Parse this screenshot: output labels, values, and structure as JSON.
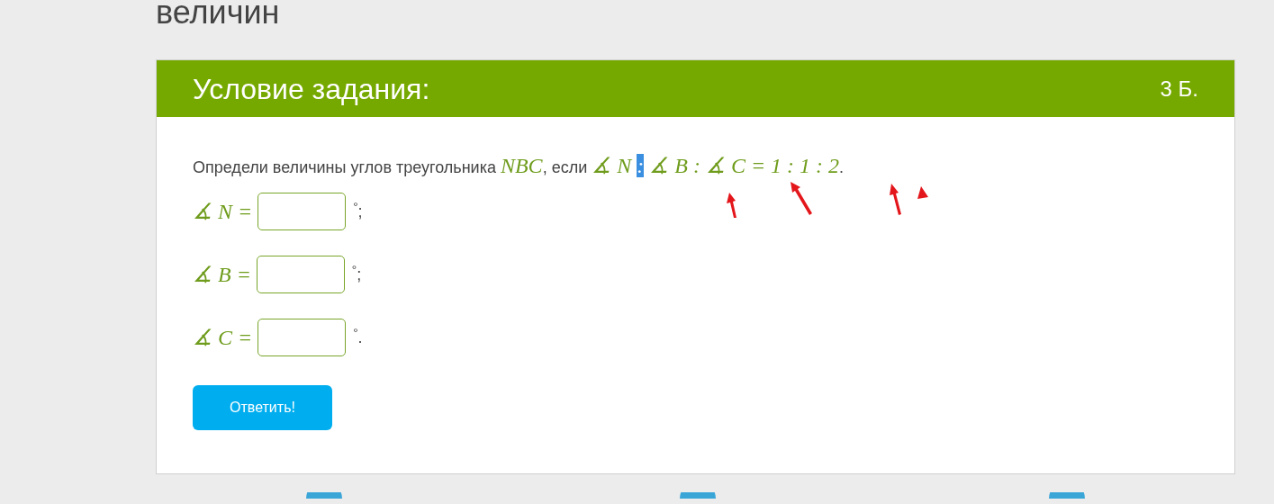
{
  "page_heading": "величин",
  "task": {
    "title": "Условие задания:",
    "points": "3 Б.",
    "statement": [
      {
        "kind": "text",
        "text": "Определи величины углов треугольника ",
        "selected": false
      },
      {
        "kind": "math",
        "text": "NBC",
        "selected": false
      },
      {
        "kind": "text",
        "text": ", если ",
        "selected": false
      },
      {
        "kind": "math",
        "text": "∡ N ",
        "selected": false
      },
      {
        "kind": "math",
        "text": ":",
        "selected": true
      },
      {
        "kind": "math",
        "text": " ∡ B : ∡ C = 1 : 1 : 2",
        "selected": false
      },
      {
        "kind": "text",
        "text": ".",
        "selected": false
      }
    ],
    "answers": [
      {
        "label": "∡ N =",
        "suffix": "$^{°}$;"
      },
      {
        "label": "∡ B =",
        "suffix": "$^{°}$;"
      },
      {
        "label": "∡ C =",
        "suffix": "$^{°}$."
      }
    ],
    "submit": "Ответить!"
  }
}
